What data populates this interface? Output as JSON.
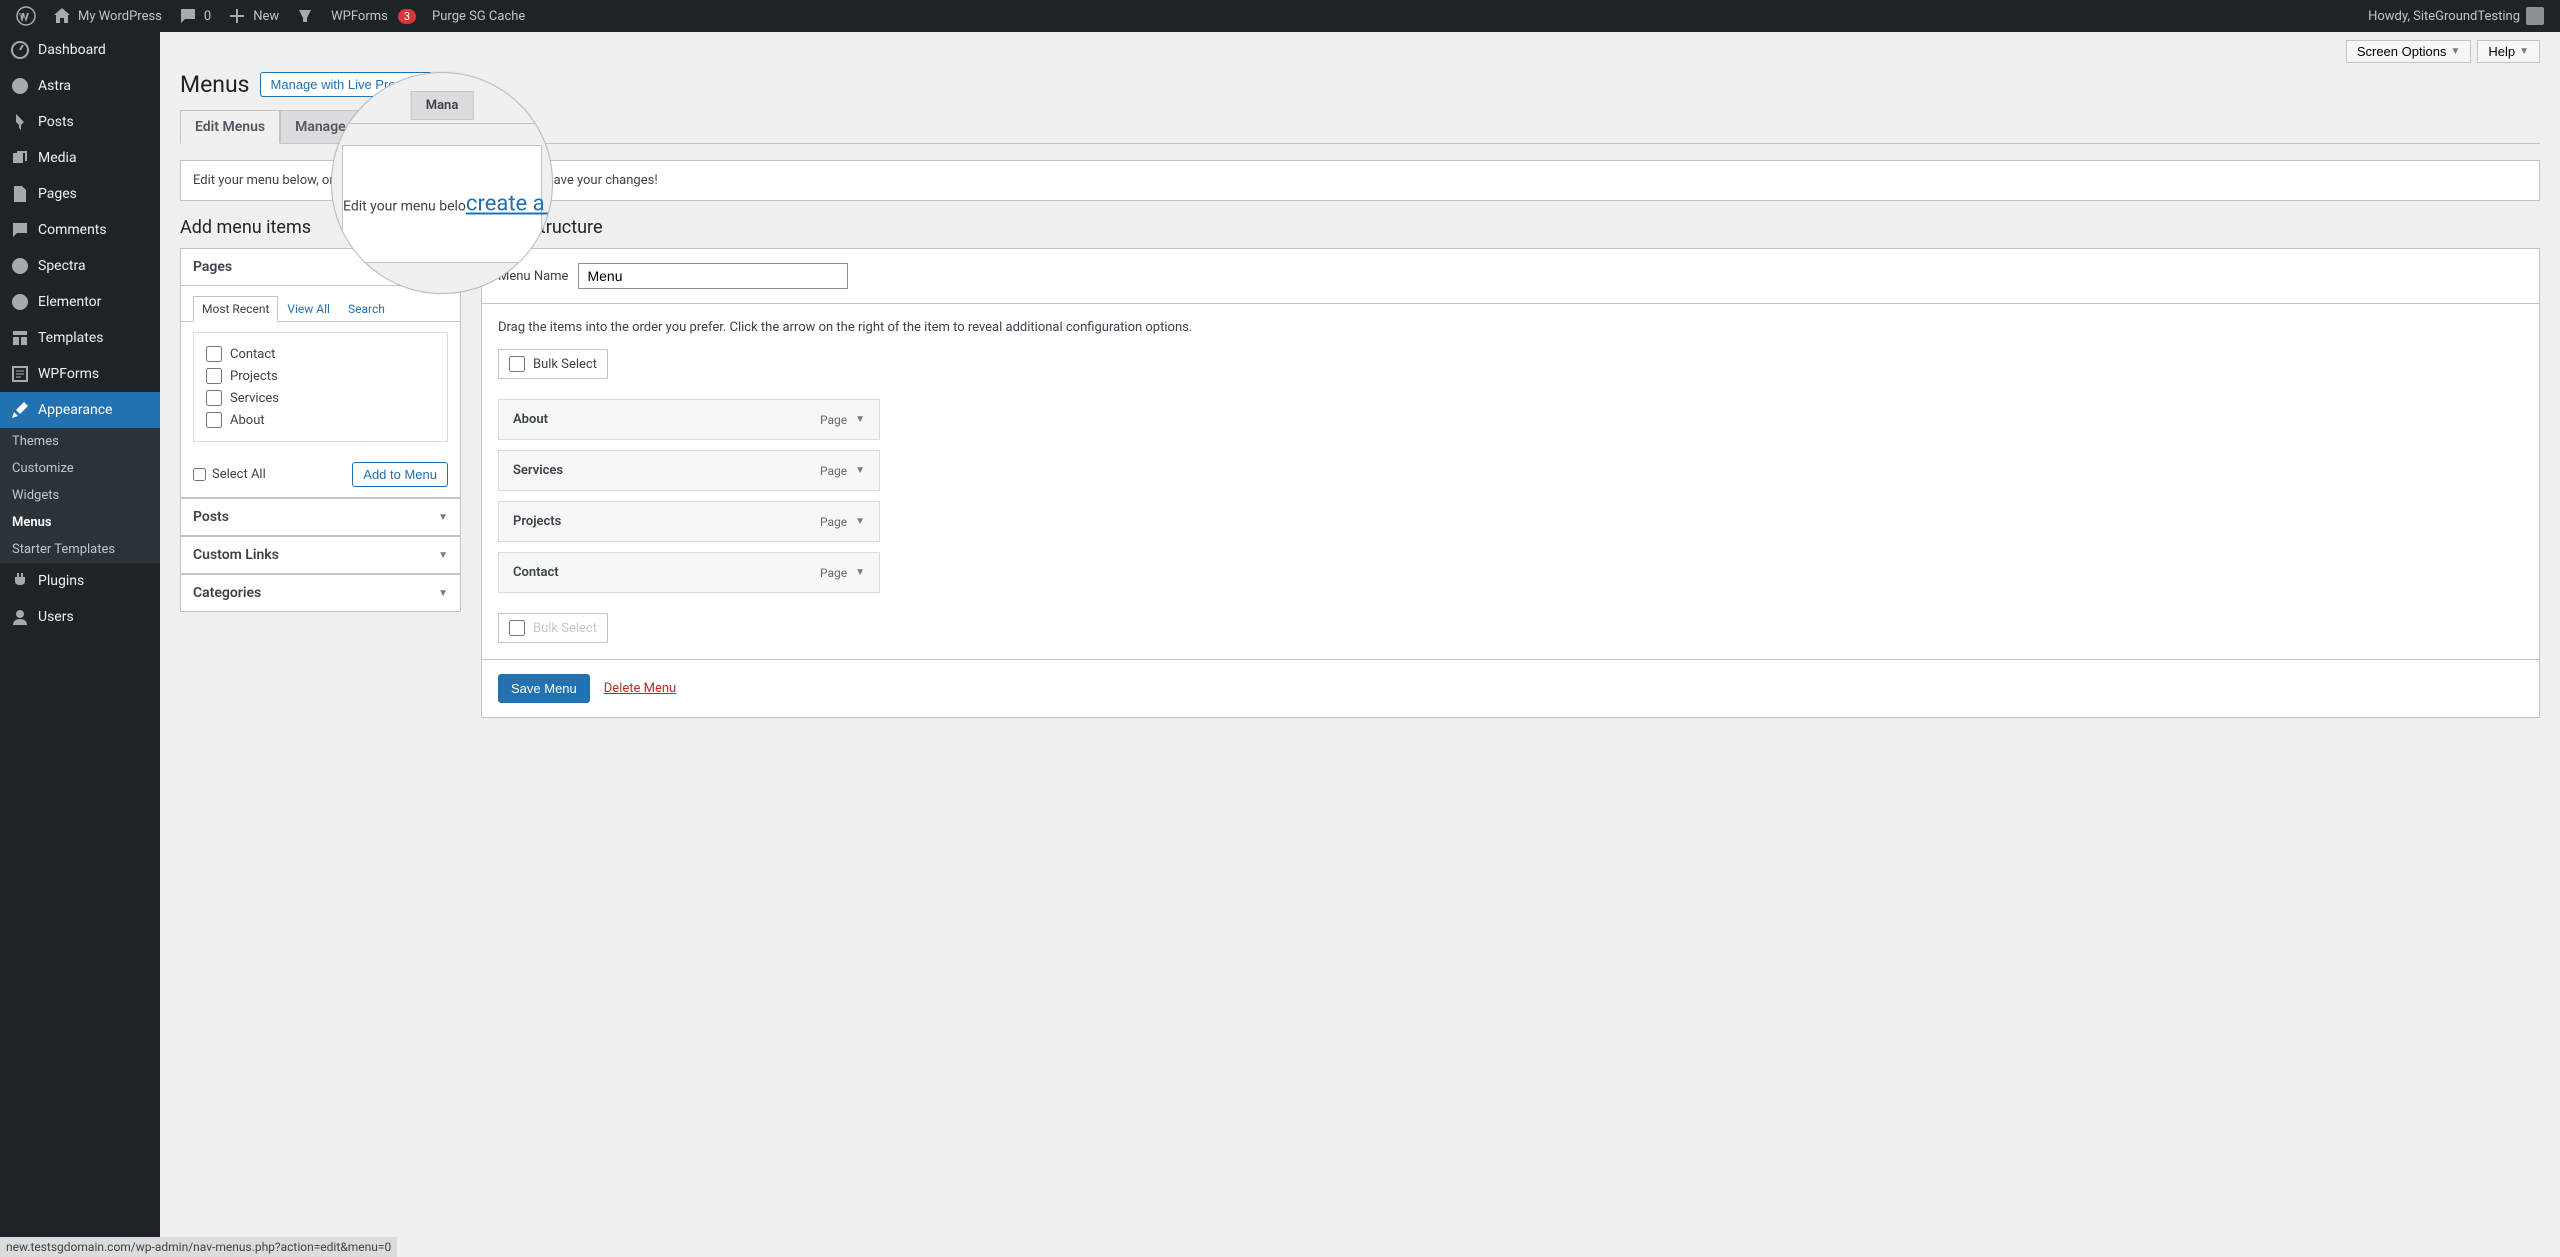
{
  "adminbar": {
    "site_name": "My WordPress",
    "comment_count": "0",
    "new_label": "New",
    "wpforms_label": "WPForms",
    "wpforms_badge": "3",
    "purge_label": "Purge SG Cache",
    "howdy": "Howdy, SiteGroundTesting"
  },
  "top_actions": {
    "screen_options": "Screen Options",
    "help": "Help"
  },
  "sidebar": {
    "items": [
      {
        "label": "Dashboard"
      },
      {
        "label": "Astra"
      },
      {
        "label": "Posts"
      },
      {
        "label": "Media"
      },
      {
        "label": "Pages"
      },
      {
        "label": "Comments"
      },
      {
        "label": "Spectra"
      },
      {
        "label": "Elementor"
      },
      {
        "label": "Templates"
      },
      {
        "label": "WPForms"
      },
      {
        "label": "Appearance"
      },
      {
        "label": "Plugins"
      },
      {
        "label": "Users"
      }
    ],
    "appearance_sub": [
      {
        "label": "Themes"
      },
      {
        "label": "Customize"
      },
      {
        "label": "Widgets"
      },
      {
        "label": "Menus"
      },
      {
        "label": "Starter Templates"
      }
    ]
  },
  "header": {
    "title": "Menus",
    "live_preview": "Manage with Live Preview"
  },
  "tabs": {
    "edit": "Edit Menus",
    "manage": "Manage Locations"
  },
  "notice": {
    "before": "Edit your menu below, or ",
    "link": "create a new menu",
    "after": ". Do not forget to save your changes!"
  },
  "add_items": {
    "title": "Add menu items",
    "pages_label": "Pages",
    "subtabs": {
      "recent": "Most Recent",
      "all": "View All",
      "search": "Search"
    },
    "pages": [
      "Contact",
      "Projects",
      "Services",
      "About"
    ],
    "select_all": "Select All",
    "add_btn": "Add to Menu",
    "posts_label": "Posts",
    "custom_links_label": "Custom Links",
    "categories_label": "Categories"
  },
  "structure": {
    "title": "Menu structure",
    "name_label": "Menu Name",
    "name_value": "Menu",
    "instructions": "Drag the items into the order you prefer. Click the arrow on the right of the item to reveal additional configuration options.",
    "bulk_select": "Bulk Select",
    "items": [
      {
        "title": "About",
        "type": "Page"
      },
      {
        "title": "Services",
        "type": "Page"
      },
      {
        "title": "Projects",
        "type": "Page"
      },
      {
        "title": "Contact",
        "type": "Page"
      }
    ],
    "save_btn": "Save Menu",
    "delete_link": "Delete Menu"
  },
  "magnifier": {
    "tab": "Mana",
    "link": "create a new menu",
    "before": "Edit your menu belo",
    "after": "not forget to save your changes!"
  },
  "statusbar": "new.testsgdomain.com/wp-admin/nav-menus.php?action=edit&menu=0"
}
